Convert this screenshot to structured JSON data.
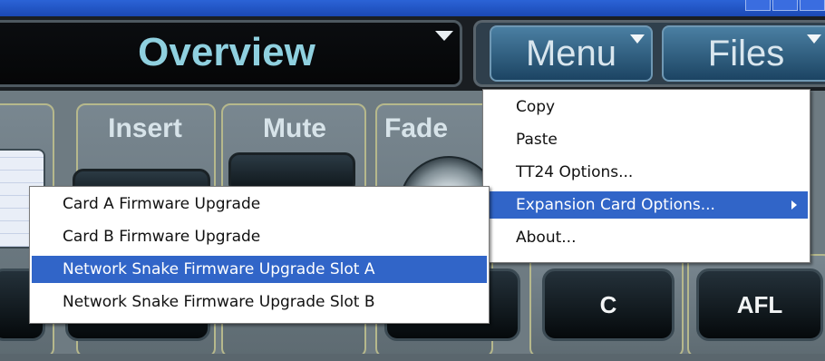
{
  "header": {
    "title": "Overview",
    "menu_label": "Menu",
    "files_label": "Files"
  },
  "strip": {
    "insert_label": "Insert",
    "mute_label": "Mute",
    "fade_label": "Fade",
    "c_label": "C",
    "afl_label": "AFL"
  },
  "main_menu": {
    "items": [
      "Copy",
      "Paste",
      "TT24 Options...",
      "Expansion Card Options...",
      "About..."
    ],
    "highlighted_index": 3
  },
  "submenu": {
    "items": [
      "Card A Firmware Upgrade",
      "Card B Firmware Upgrade",
      "Network Snake Firmware Upgrade Slot A",
      "Network Snake Firmware Upgrade Slot B"
    ],
    "highlighted_index": 2
  },
  "colors": {
    "accent_highlight": "#3165c8",
    "title_text": "#8fd0df",
    "panel_button": "#1c4463"
  },
  "icons": {
    "dropdown": "triangle-down-icon",
    "submenu": "triangle-right-icon"
  }
}
